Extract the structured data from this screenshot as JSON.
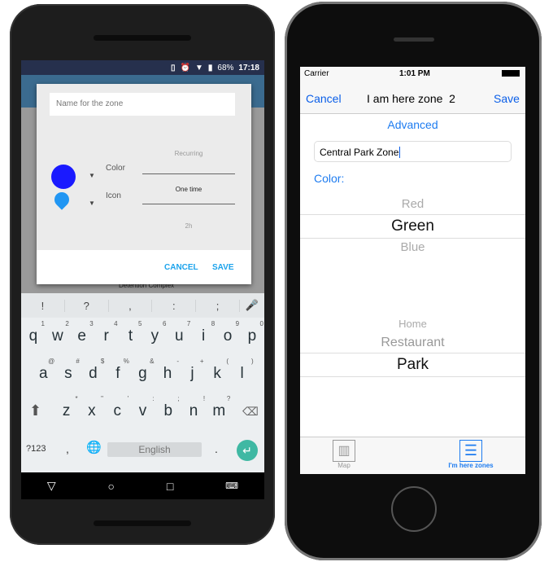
{
  "android": {
    "status": {
      "battery": "68%",
      "time": "17:18"
    },
    "dialog": {
      "name_placeholder": "Name for the zone",
      "color_label": "Color",
      "icon_label": "Icon",
      "color_value": "#1a1aff",
      "options": [
        "Recurring",
        "One time",
        "2h"
      ],
      "cancel": "CANCEL",
      "save": "SAVE"
    },
    "map_label": "Detention Complex",
    "keyboard": {
      "suggestions": [
        "!",
        "?",
        ",",
        ":",
        ";"
      ],
      "row1": [
        [
          "q",
          "1"
        ],
        [
          "w",
          "2"
        ],
        [
          "e",
          "3"
        ],
        [
          "r",
          "4"
        ],
        [
          "t",
          "5"
        ],
        [
          "y",
          "6"
        ],
        [
          "u",
          "7"
        ],
        [
          "i",
          "8"
        ],
        [
          "o",
          "9"
        ],
        [
          "p",
          "0"
        ]
      ],
      "row2": [
        [
          "a",
          "@"
        ],
        [
          "s",
          "#"
        ],
        [
          "d",
          "$"
        ],
        [
          "f",
          "%"
        ],
        [
          "g",
          "&"
        ],
        [
          "h",
          "-"
        ],
        [
          "j",
          "+"
        ],
        [
          "k",
          "("
        ],
        [
          "l",
          ")"
        ]
      ],
      "row3": [
        [
          "z",
          "*"
        ],
        [
          "x",
          "\""
        ],
        [
          "c",
          "'"
        ],
        [
          "v",
          ":"
        ],
        [
          "b",
          ";"
        ],
        [
          "n",
          "!"
        ],
        [
          "m",
          "?"
        ]
      ],
      "symbols": "?123",
      "comma": ",",
      "space": "English",
      "period": "."
    }
  },
  "ios": {
    "status": {
      "carrier": "Carrier",
      "time": "1:01 PM"
    },
    "nav": {
      "cancel": "Cancel",
      "title": "I am here zone  2",
      "save": "Save"
    },
    "advanced": "Advanced",
    "zone_name": "Central Park Zone",
    "color_label": "Color:",
    "color_picker": [
      "Red",
      "Green",
      "Blue"
    ],
    "icon_picker": [
      "Home",
      "Restaurant",
      "Park"
    ],
    "tabs": [
      {
        "label": "Map"
      },
      {
        "label": "I'm here zones"
      }
    ],
    "accent": "#0a5ee8"
  }
}
